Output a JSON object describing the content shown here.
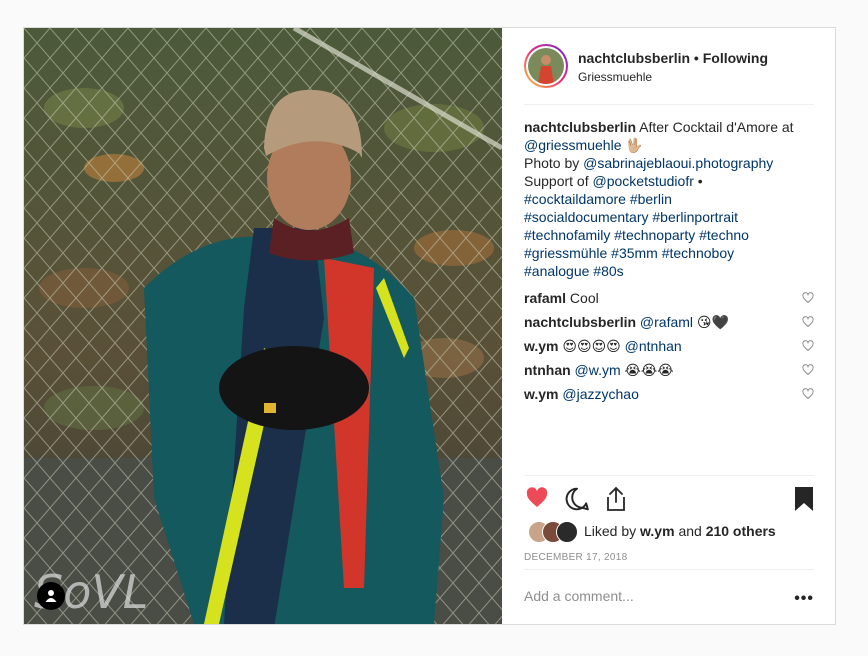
{
  "post": {
    "username": "nachtclubsberlin",
    "separator": "•",
    "follow_label": "Following",
    "location": "Griessmuehle"
  },
  "caption": {
    "username": "nachtclubsberlin",
    "text_1": "After Cocktail d'Amore at",
    "mention_1": "@griessmuehle",
    "emoji_1": "🖖🏼",
    "photo_by": "Photo by",
    "mention_2": "@sabrinajeblaoui.photography",
    "support_of": "Support of",
    "mention_3": "@pocketstudiofr",
    "bullet": "•",
    "hashtags_1": "#cocktaildamore #berlin",
    "hashtags_2": "#socialdocumentary #berlinportrait",
    "hashtags_3": "#technofamily #technoparty #techno",
    "hashtags_4": "#griessmühle #35mm #technoboy",
    "hashtags_5": "#analogue #80s"
  },
  "comments": [
    {
      "user": "rafaml",
      "text": "Cool",
      "mention": "",
      "emoji": ""
    },
    {
      "user": "nachtclubsberlin",
      "text": "",
      "mention": "@rafaml",
      "emoji": "😘🖤"
    },
    {
      "user": "w.ym",
      "text": "",
      "mention": "@ntnhan",
      "emoji": "😍😍😍😍"
    },
    {
      "user": "ntnhan",
      "text": "",
      "mention": "@w.ym",
      "emoji": "😭😭😭"
    },
    {
      "user": "w.ym",
      "text": "",
      "mention": "@jazzychao",
      "emoji": ""
    }
  ],
  "likes": {
    "prefix": "Liked by",
    "user": "w.ym",
    "and": "and",
    "others": "210 others"
  },
  "date": "DECEMBER 17, 2018",
  "add_comment": {
    "placeholder": "Add a comment...",
    "more": "•••"
  },
  "icons": {
    "like": "heart-filled-icon",
    "comment": "speech-bubble-icon",
    "share": "share-icon",
    "save": "bookmark-filled-icon",
    "comment_like": "heart-outline-icon",
    "tag": "user-tag-icon"
  },
  "colors": {
    "like_red": "#ed4956",
    "link_blue": "#003569",
    "muted": "#8e8e8e"
  }
}
